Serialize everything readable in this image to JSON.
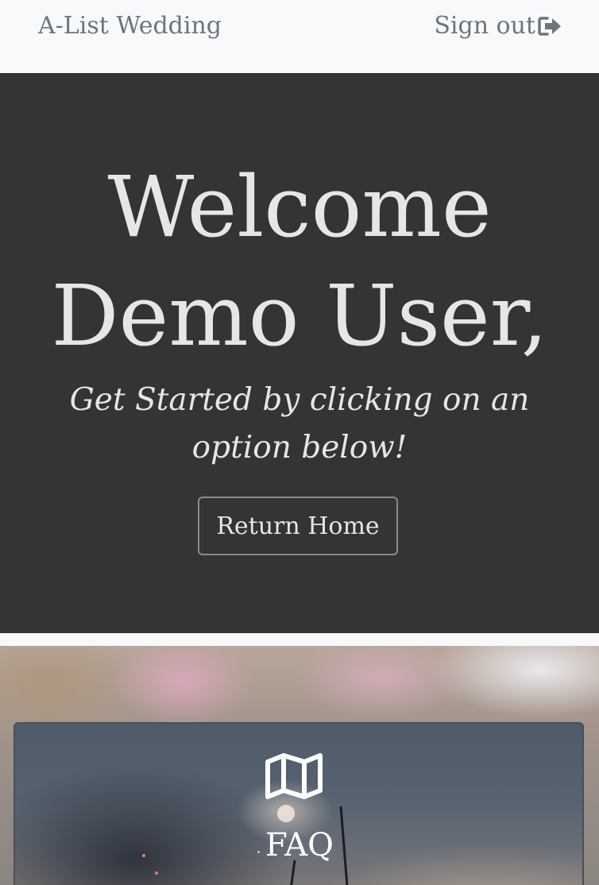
{
  "navbar": {
    "brand": "A-List Wedding",
    "signout_label": "Sign out",
    "signout_icon": "sign-out-icon"
  },
  "hero": {
    "title_line1": "Welcome",
    "title_line2": "Demo User,",
    "subtitle": "Get Started by clicking on an option below!",
    "button_label": "Return Home"
  },
  "cards": [
    {
      "icon": "map-icon",
      "title": "FAQ"
    }
  ],
  "colors": {
    "navbar_bg": "#f8f9fa",
    "navbar_text": "#6c757d",
    "hero_bg": "#343434",
    "hero_text": "#e6e6e6"
  }
}
